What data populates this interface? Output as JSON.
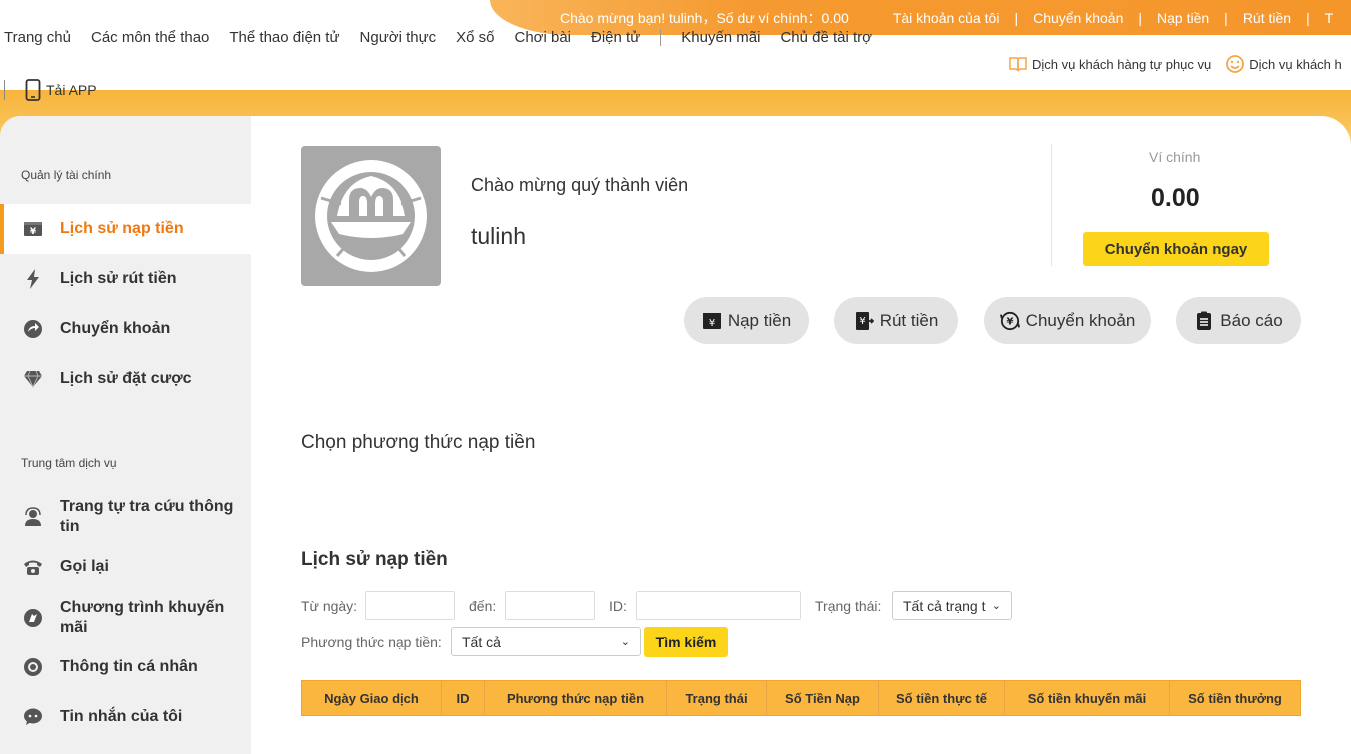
{
  "top_info": {
    "welcome": "Chào mừng bạn!  tulinh，Số dư ví chính：0.00",
    "links": [
      "Tài khoản của tôi",
      "Chuyển khoản",
      "Nạp tiền",
      "Rút tiền",
      "T"
    ],
    "separator": "|"
  },
  "main_nav": [
    "Trang chủ",
    "Các môn thể thao",
    "Thể thao điện tử",
    "Người thực",
    "Xổ số",
    "Chơi bài",
    "Điện tử",
    "Khuyến mãi",
    "Chủ đề tài trợ"
  ],
  "service_links": [
    "Dịch vụ khách hàng tự phục vụ",
    "Dịch vụ khách h"
  ],
  "app_link": "Tải APP",
  "sidebar": {
    "section1": "Quản lý tài chính",
    "finance_items": [
      {
        "label": "Lịch sử nạp tiền",
        "icon": "yen-card-icon",
        "active": true
      },
      {
        "label": "Lịch sử rút tiền",
        "icon": "lightning-icon",
        "active": false
      },
      {
        "label": "Chuyển khoản",
        "icon": "transfer-arrow-icon",
        "active": false
      },
      {
        "label": "Lịch sử đặt cược",
        "icon": "diamond-icon",
        "active": false
      }
    ],
    "section2": "Trung tâm dịch vụ",
    "service_items": [
      {
        "label": "Trang tự tra cứu thông tin",
        "icon": "support-agent-icon"
      },
      {
        "label": "Gọi lại",
        "icon": "phone-icon"
      },
      {
        "label": "Chương trình khuyến mãi",
        "icon": "promo-icon"
      },
      {
        "label": "Thông tin cá nhân",
        "icon": "profile-icon"
      },
      {
        "label": "Tin nhắn của tôi",
        "icon": "message-icon"
      }
    ]
  },
  "profile": {
    "greeting": "Chào mừng quý thành viên",
    "username": "tulinh"
  },
  "wallet": {
    "label": "Ví chính",
    "amount": "0.00",
    "transfer_button": "Chuyển khoản ngay"
  },
  "actions": [
    "Nạp tiền",
    "Rút tiền",
    "Chuyển khoản",
    "Báo cáo"
  ],
  "deposit": {
    "choose_method": "Chọn phương thức nạp tiền"
  },
  "history": {
    "title": "Lịch sử nạp tiền",
    "from_label": "Từ ngày:",
    "to_label": "đến:",
    "id_label": "ID:",
    "status_label": "Trạng thái:",
    "status_value": "Tất cả trạng t",
    "method_label": "Phương thức nạp tiền:",
    "method_value": "Tất cả",
    "search_button": "Tìm kiếm",
    "columns": [
      "Ngày Giao dịch",
      "ID",
      "Phương thức nạp tiền",
      "Trạng thái",
      "Số Tiền Nạp",
      "Số tiền thực tế",
      "Số tiền khuyến mãi",
      "Số tiền thưởng"
    ]
  },
  "colors": {
    "accent_orange": "#f5962b",
    "active_text": "#f0780f",
    "button_yellow": "#fcd41a",
    "table_header": "#fbb640"
  }
}
